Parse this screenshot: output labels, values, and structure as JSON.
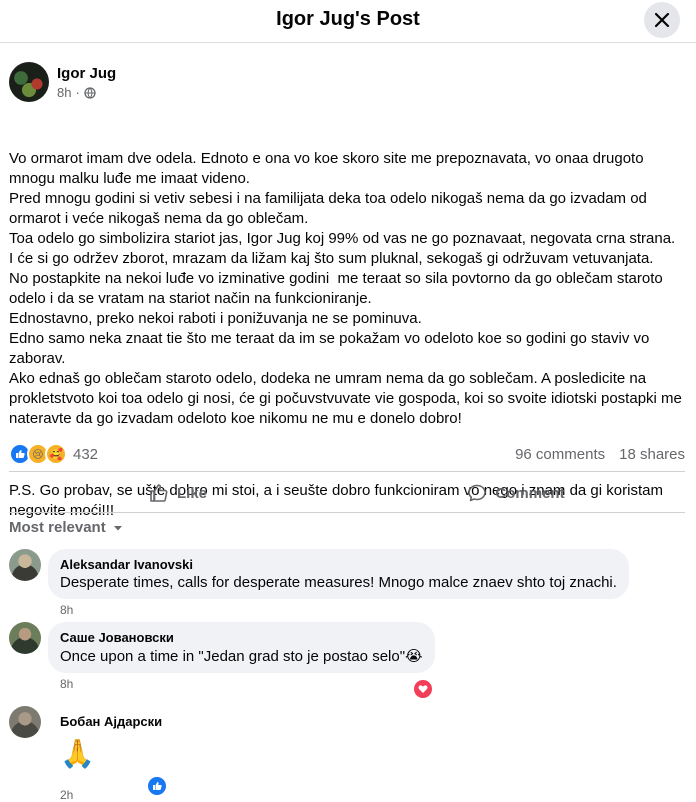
{
  "header": {
    "title": "Igor Jug's Post"
  },
  "post": {
    "author": "Igor Jug",
    "time": "8h",
    "paragraphs": [
      "Vo ormarot imam dve odela. Ednoto e ona vo koe skoro site me prepoznavata, vo onaa drugoto mnogu malku luđe me imaat videno.\nPred mnogu godini si vetiv sebesi i na familijata deka toa odelo nikogaš nema da go izvadam od ormarot i veće nikogaš nema da go oblečam.\nToa odelo go simbolizira stariot jas, Igor Jug koj 99% od vas ne go poznavaat, negovata crna strana.\nI će si go održev zborot, mrazam da ližam kaj što sum pluknal, sekogaš gi održuvam vetuvanjata.\nNo postapkite na nekoi luđe vo izminative godini  me teraat so sila povtorno da go oblečam staroto odelo i da se vratam na stariot način na funkcioniranje.\nEdnostavno, preko nekoi raboti i ponižuvanja ne se pominuva.\nEdno samo neka znaat tie što me teraat da im se pokažam vo odeloto koe so godini go staviv vo zaborav.\nAko ednaš go oblečam staroto odelo, dodeka ne umram nema da go soblečam. A posledicite na prokletstvoto koi toa odelo gi nosi, će gi počuvstvuvate vie gospoda, koi so svoite idiotski postapki me nateravte da go izvadam odeloto koe nikomu ne mu e donelo dobro!",
      "P.S. Go probav, se ušte dobro mi stoi, a i seušte dobro funkcioniram vo nego i znam da gi koristam negovite moći!!!"
    ],
    "reaction_count": "432",
    "comments_count": "96 comments",
    "shares_count": "18 shares"
  },
  "actions": {
    "like": "Like",
    "comment": "Comment"
  },
  "filter": {
    "label": "Most relevant"
  },
  "comments": [
    {
      "name": "Aleksandar Ivanovski",
      "text": "Desperate times, calls for desperate measures! Mnogo malce znaev shto toj znachi.",
      "time": "8h"
    },
    {
      "name": "Саше Јовановски",
      "text": "Once upon a time in \"Jedan grad sto je postao selo\"😭",
      "time": "8h"
    },
    {
      "name": "Бобан Ајдарски",
      "text": "🙏",
      "time": "2h"
    }
  ],
  "colors": {
    "accent": "#1877f2",
    "love": "#f33e58",
    "bubble": "#f0f2f5",
    "muted": "#65676b"
  }
}
